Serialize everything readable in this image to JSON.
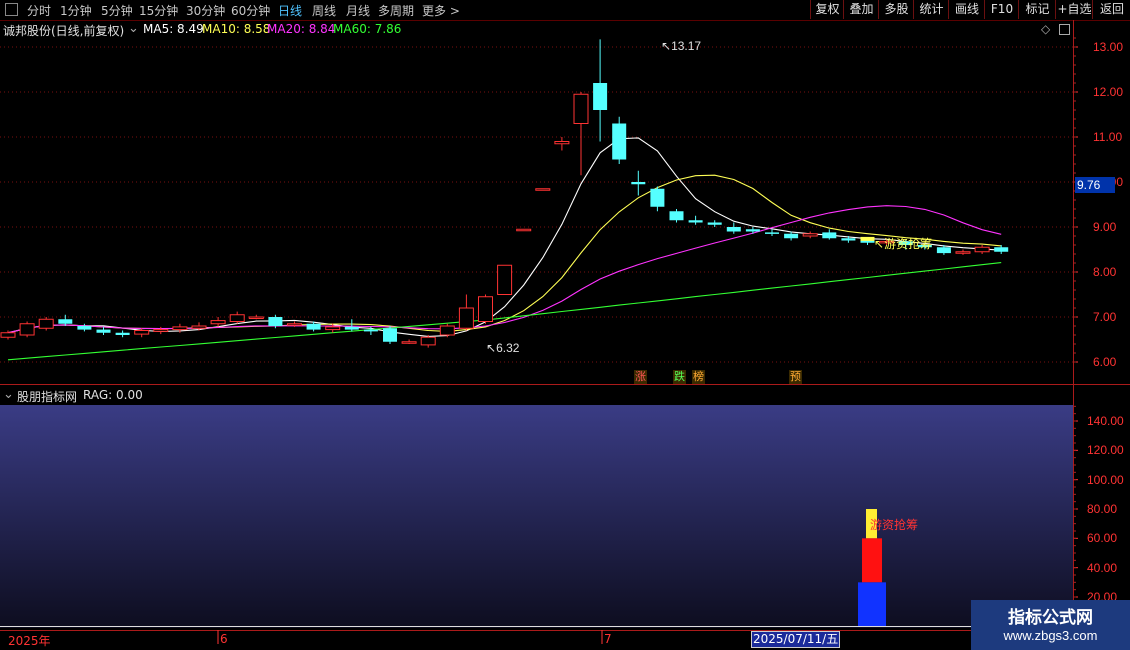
{
  "toolbar": {
    "left_items": [
      {
        "label": "分时",
        "active": false
      },
      {
        "label": "1分钟",
        "active": false
      },
      {
        "label": "5分钟",
        "active": false
      },
      {
        "label": "15分钟",
        "active": false
      },
      {
        "label": "30分钟",
        "active": false
      },
      {
        "label": "60分钟",
        "active": false
      },
      {
        "label": "日线",
        "active": true
      },
      {
        "label": "周线",
        "active": false
      },
      {
        "label": "月线",
        "active": false
      },
      {
        "label": "多周期",
        "active": false
      },
      {
        "label": "更多 >",
        "active": false
      }
    ],
    "right_items": [
      "复权",
      "叠加",
      "多股",
      "统计",
      "画线",
      "F10",
      "标记",
      "+自选",
      "返回"
    ]
  },
  "chart_header": {
    "stock": "诚邦股份(日线,前复权)",
    "ma5": "MA5: 8.49",
    "ma10": "MA10: 8.58",
    "ma20": "MA20: 8.84",
    "ma60": "MA60: 7.86"
  },
  "colors": {
    "ma5": "#ffffff",
    "ma10": "#ffff55",
    "ma20": "#ff33ff",
    "ma60": "#33ff33",
    "up": "#ff3333",
    "down": "#55ffff",
    "axis": "#ff3333"
  },
  "price_axis": {
    "labels": [
      "13.00",
      "12.00",
      "11.00",
      "10.00",
      "9.00",
      "8.00",
      "7.00",
      "6.00"
    ],
    "current": "9.76"
  },
  "price_annotations": {
    "high": "13.17",
    "low": "6.32",
    "signal": "游资抢筹"
  },
  "event_marks": [
    {
      "text": "涨",
      "color": "#ff5555"
    },
    {
      "text": "跌",
      "color": "#55ff55"
    },
    {
      "text": "榜",
      "color": "#ffaa33"
    },
    {
      "text": "预",
      "color": "#ffaa33"
    }
  ],
  "indicator_header": {
    "name": "股朋指标网",
    "value": "RAG: 0.00"
  },
  "indicator_axis": {
    "labels": [
      "140.00",
      "120.00",
      "100.00",
      "80.00",
      "60.00",
      "40.00",
      "20.00"
    ]
  },
  "indicator_label": "游资抢筹",
  "indicator_bars": {
    "blue": 30,
    "red": 60,
    "yellow": 80
  },
  "date_axis": {
    "labels": [
      "2025年",
      "6",
      "7"
    ],
    "current": "2025/07/11/五"
  },
  "watermark": {
    "line1": "指标公式网",
    "line2": "www.zbgs3.com"
  },
  "chart_data": {
    "type": "candlestick",
    "ylim": [
      5.6,
      13.3
    ],
    "candles": [
      [
        6.55,
        6.65,
        6.5,
        6.7
      ],
      [
        6.6,
        6.85,
        6.55,
        6.9
      ],
      [
        6.75,
        6.95,
        6.7,
        7.0
      ],
      [
        6.95,
        6.85,
        6.8,
        7.05
      ],
      [
        6.8,
        6.72,
        6.68,
        6.85
      ],
      [
        6.72,
        6.65,
        6.6,
        6.78
      ],
      [
        6.65,
        6.6,
        6.55,
        6.7
      ],
      [
        6.62,
        6.7,
        6.55,
        6.75
      ],
      [
        6.68,
        6.72,
        6.62,
        6.78
      ],
      [
        6.72,
        6.78,
        6.65,
        6.85
      ],
      [
        6.75,
        6.8,
        6.7,
        6.88
      ],
      [
        6.85,
        6.92,
        6.78,
        7.0
      ],
      [
        6.9,
        7.05,
        6.85,
        7.12
      ],
      [
        7.0,
        7.0,
        6.95,
        7.05
      ],
      [
        7.0,
        6.8,
        6.75,
        7.05
      ],
      [
        6.82,
        6.85,
        6.78,
        6.9
      ],
      [
        6.85,
        6.72,
        6.68,
        6.9
      ],
      [
        6.72,
        6.78,
        6.65,
        6.85
      ],
      [
        6.78,
        6.72,
        6.68,
        6.95
      ],
      [
        6.72,
        6.68,
        6.6,
        6.78
      ],
      [
        6.75,
        6.45,
        6.4,
        6.8
      ],
      [
        6.45,
        6.45,
        6.4,
        6.5
      ],
      [
        6.38,
        6.55,
        6.32,
        6.6
      ],
      [
        6.6,
        6.8,
        6.55,
        6.85
      ],
      [
        6.75,
        7.2,
        6.7,
        7.5
      ],
      [
        6.9,
        7.45,
        6.85,
        7.5
      ],
      [
        7.5,
        8.15,
        7.5,
        8.15
      ],
      [
        8.95,
        8.95,
        8.95,
        8.95
      ],
      [
        9.85,
        9.85,
        9.85,
        9.85
      ],
      [
        10.85,
        10.9,
        10.7,
        11.0
      ],
      [
        11.3,
        11.95,
        10.15,
        12.0
      ],
      [
        12.2,
        11.6,
        10.9,
        13.17
      ],
      [
        11.3,
        10.5,
        10.4,
        11.45
      ],
      [
        10.0,
        9.95,
        9.7,
        10.25
      ],
      [
        9.85,
        9.45,
        9.35,
        9.9
      ],
      [
        9.35,
        9.15,
        9.1,
        9.4
      ],
      [
        9.15,
        9.1,
        9.05,
        9.25
      ],
      [
        9.1,
        9.05,
        9.0,
        9.15
      ],
      [
        9.0,
        8.9,
        8.85,
        9.1
      ],
      [
        8.95,
        8.9,
        8.85,
        9.0
      ],
      [
        8.88,
        8.85,
        8.8,
        8.95
      ],
      [
        8.85,
        8.75,
        8.7,
        8.9
      ],
      [
        8.8,
        8.85,
        8.75,
        8.9
      ],
      [
        8.88,
        8.75,
        8.72,
        8.95
      ],
      [
        8.75,
        8.7,
        8.65,
        8.8
      ],
      [
        8.7,
        8.65,
        8.6,
        8.75
      ],
      [
        8.65,
        8.68,
        8.6,
        8.72
      ],
      [
        8.68,
        8.6,
        8.5,
        8.72
      ],
      [
        8.6,
        8.55,
        8.5,
        8.65
      ],
      [
        8.55,
        8.42,
        8.38,
        8.6
      ],
      [
        8.42,
        8.45,
        8.38,
        8.5
      ],
      [
        8.45,
        8.55,
        8.4,
        8.6
      ],
      [
        8.55,
        8.45,
        8.4,
        8.6
      ]
    ]
  }
}
